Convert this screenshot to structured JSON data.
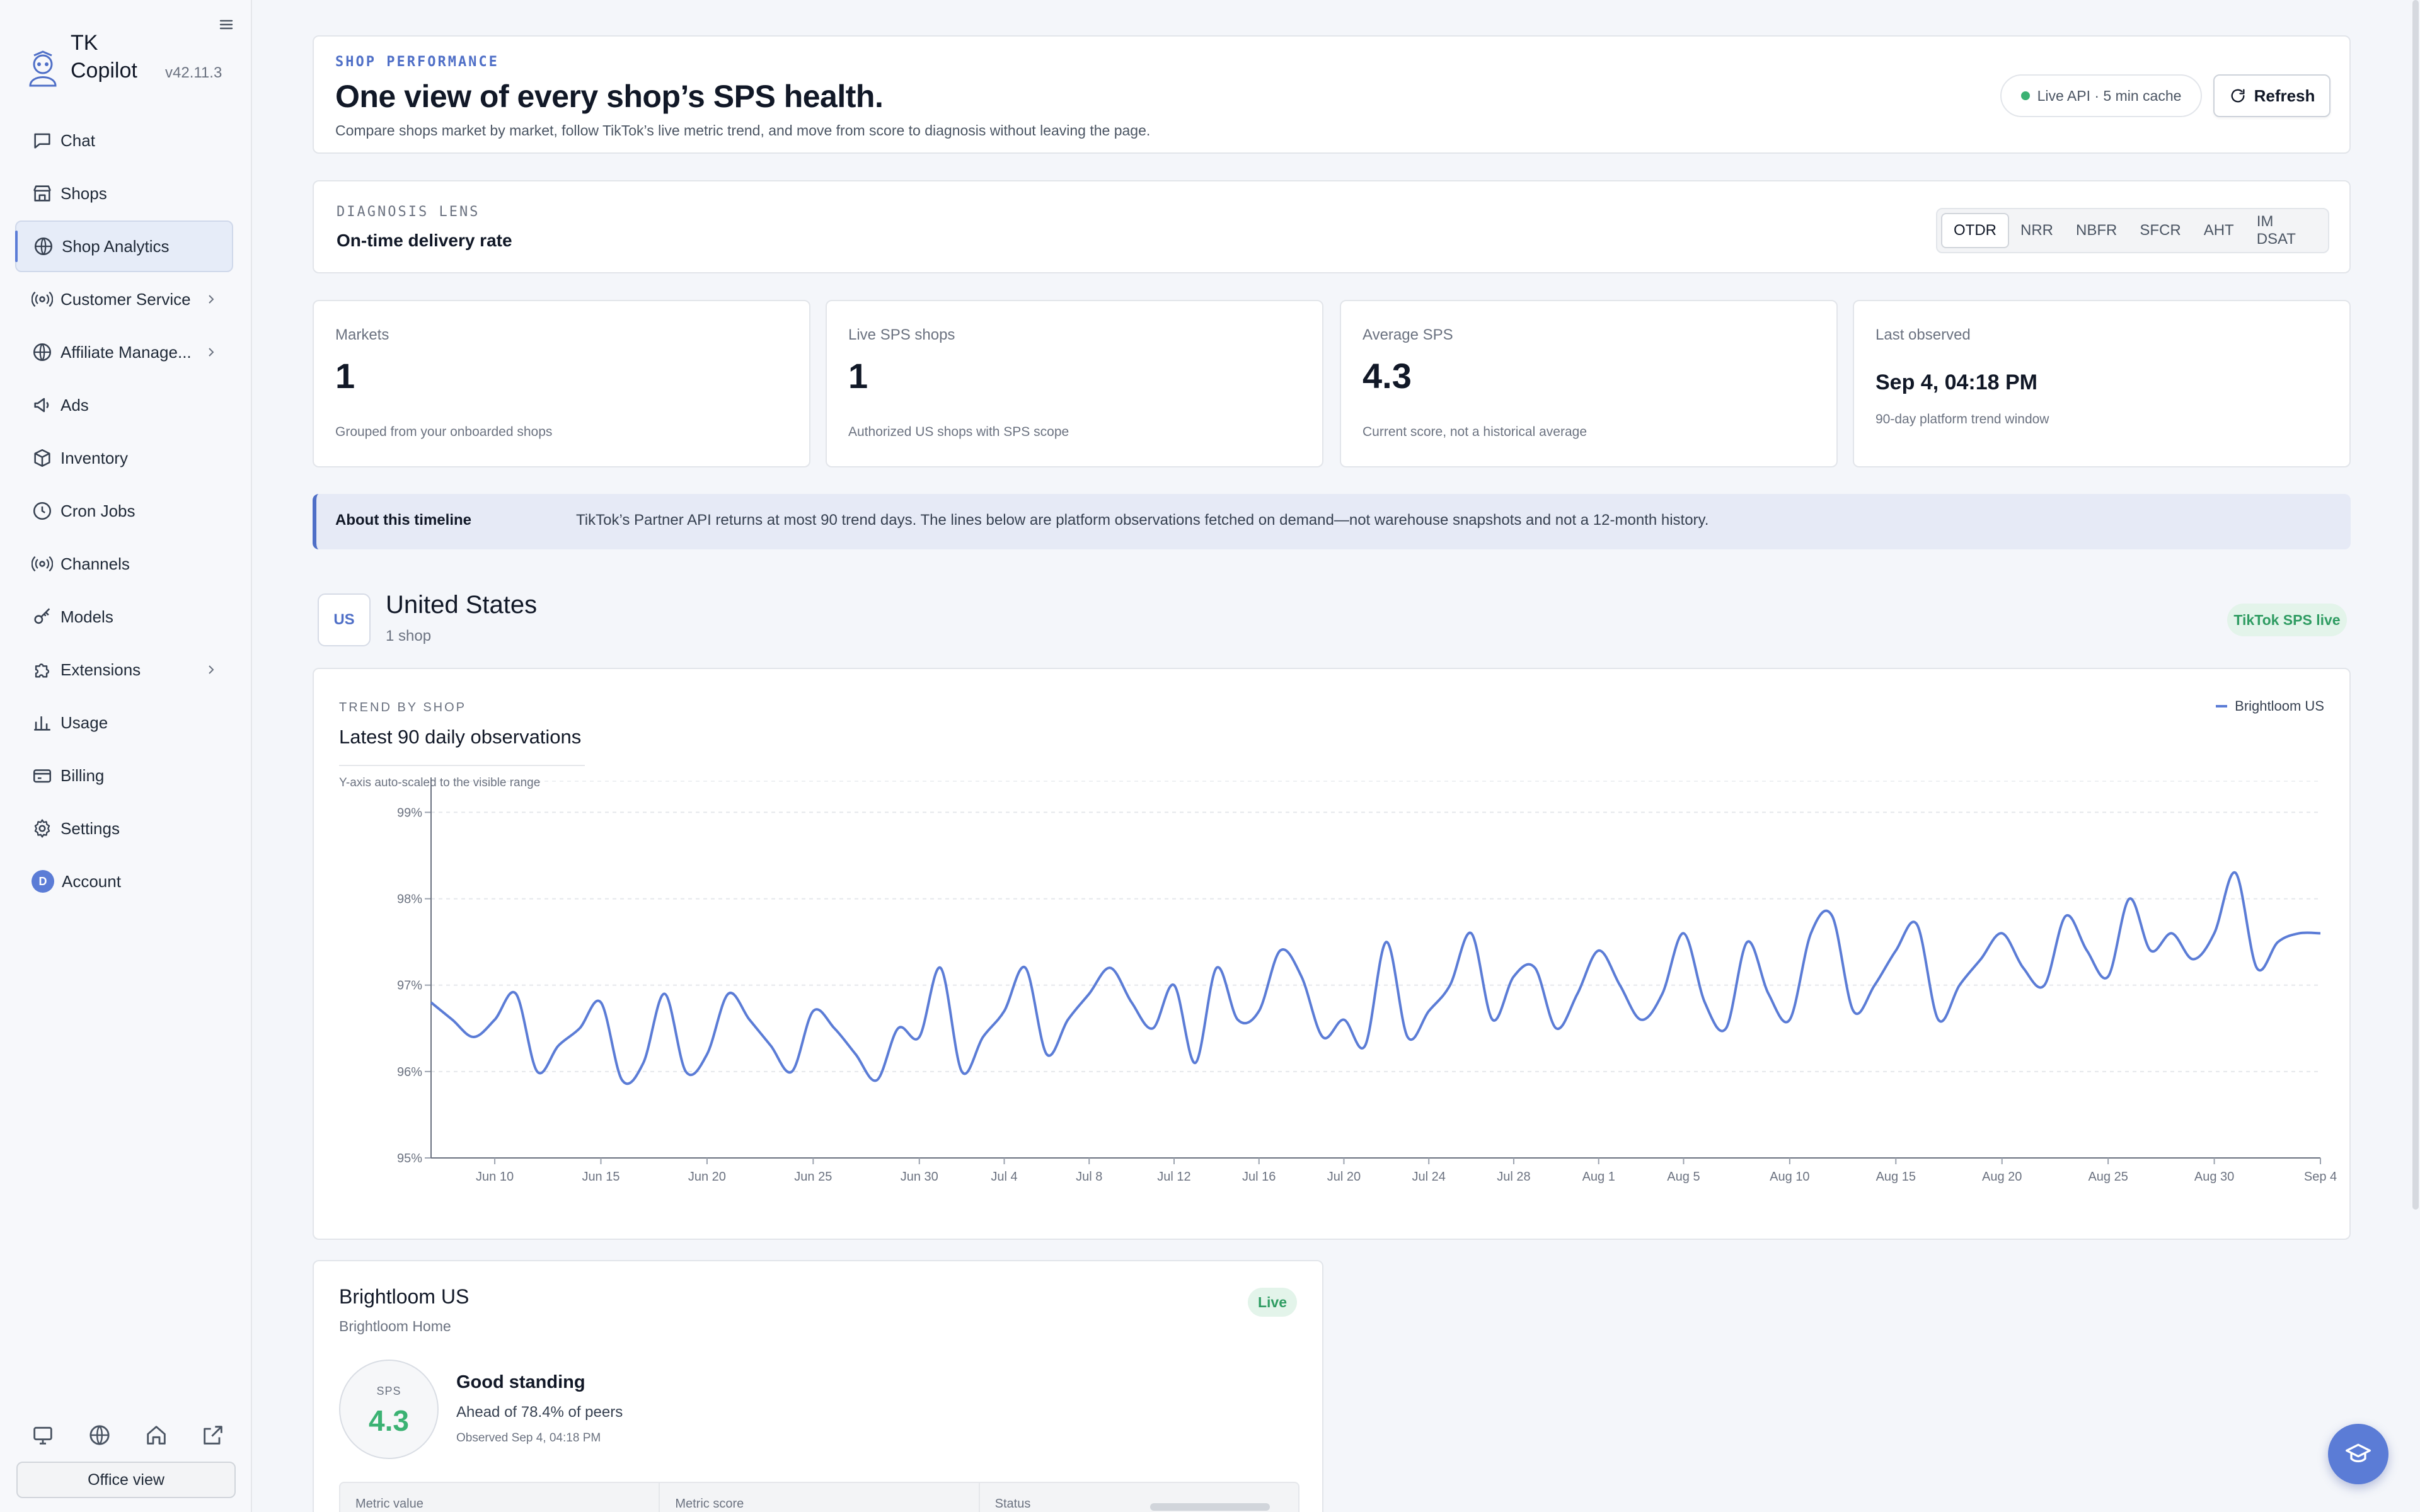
{
  "app": {
    "name": "TK Copilot",
    "version": "v42.11.3"
  },
  "sidebar": {
    "items": [
      {
        "label": "Chat",
        "icon": "chat-icon"
      },
      {
        "label": "Shops",
        "icon": "store-icon"
      },
      {
        "label": "Shop Analytics",
        "icon": "globe-icon",
        "active": true
      },
      {
        "label": "Customer Service",
        "icon": "broadcast-icon",
        "has_children": true
      },
      {
        "label": "Affiliate Manage...",
        "icon": "globe-icon",
        "has_children": true
      },
      {
        "label": "Ads",
        "icon": "megaphone-icon"
      },
      {
        "label": "Inventory",
        "icon": "box-icon"
      },
      {
        "label": "Cron Jobs",
        "icon": "clock-icon"
      },
      {
        "label": "Channels",
        "icon": "broadcast-icon"
      },
      {
        "label": "Models",
        "icon": "key-icon"
      },
      {
        "label": "Extensions",
        "icon": "puzzle-icon",
        "has_children": true
      },
      {
        "label": "Usage",
        "icon": "bar-chart-icon"
      },
      {
        "label": "Billing",
        "icon": "credit-card-icon"
      },
      {
        "label": "Settings",
        "icon": "gear-icon"
      },
      {
        "label": "Account",
        "icon": "avatar",
        "initial": "D"
      }
    ],
    "office_view": "Office view"
  },
  "hero": {
    "eyebrow": "SHOP PERFORMANCE",
    "title": "One view of every shop’s SPS health.",
    "subtitle": "Compare shops market by market, follow TikTok’s live metric trend, and move from score to diagnosis without leaving the page.",
    "status": "Live API · 5 min cache",
    "refresh": "Refresh"
  },
  "lens": {
    "eyebrow": "DIAGNOSIS LENS",
    "title": "On-time delivery rate",
    "options": [
      "OTDR",
      "NRR",
      "NBFR",
      "SFCR",
      "AHT",
      "IM DSAT"
    ],
    "selected": "OTDR"
  },
  "stats": [
    {
      "label": "Markets",
      "value": "1",
      "note": "Grouped from your onboarded shops"
    },
    {
      "label": "Live SPS shops",
      "value": "1",
      "note": "Authorized US shops with SPS scope"
    },
    {
      "label": "Average SPS",
      "value": "4.3",
      "note": "Current score, not a historical average"
    },
    {
      "label": "Last observed",
      "value": "Sep 4, 04:18 PM",
      "note": "90-day platform trend window"
    }
  ],
  "about": {
    "title": "About this timeline",
    "text": "TikTok’s Partner API returns at most 90 trend days. The lines below are platform observations fetched on demand—not warehouse snapshots and not a 12-month history."
  },
  "market": {
    "code": "US",
    "name": "United States",
    "count": "1 shop",
    "badge": "TikTok SPS live"
  },
  "chart": {
    "eyebrow": "TREND BY SHOP",
    "title": "Latest 90 daily observations",
    "note": "Y-axis auto-scaled to the visible range",
    "legend": "Brightloom US",
    "line_color": "#5b7cd6"
  },
  "chart_data": {
    "type": "line",
    "title": "Latest 90 daily observations",
    "ylim": [
      95,
      99.2
    ],
    "yticks": [
      "95%",
      "96%",
      "97%",
      "98%",
      "99%"
    ],
    "xticks": [
      "Jun 10",
      "Jun 15",
      "Jun 20",
      "Jun 25",
      "Jun 30",
      "Jul 4",
      "Jul 8",
      "Jul 12",
      "Jul 16",
      "Jul 20",
      "Jul 24",
      "Jul 28",
      "Aug 1",
      "Aug 5",
      "Aug 10",
      "Aug 15",
      "Aug 20",
      "Aug 25",
      "Aug 30",
      "Sep 4"
    ],
    "x_start": "Jun 7",
    "x_end": "Sep 4",
    "grid": true,
    "legend_position": "top-right",
    "series": [
      {
        "name": "Brightloom US",
        "values": [
          96.8,
          96.6,
          96.4,
          96.6,
          96.9,
          96.0,
          96.3,
          96.5,
          96.8,
          95.9,
          96.1,
          96.9,
          96.0,
          96.2,
          96.9,
          96.6,
          96.3,
          96.0,
          96.7,
          96.5,
          96.2,
          95.9,
          96.5,
          96.4,
          97.2,
          96.0,
          96.4,
          96.7,
          97.2,
          96.2,
          96.6,
          96.9,
          97.2,
          96.8,
          96.5,
          97.0,
          96.1,
          97.2,
          96.6,
          96.7,
          97.4,
          97.1,
          96.4,
          96.6,
          96.3,
          97.5,
          96.4,
          96.7,
          97.0,
          97.6,
          96.6,
          97.1,
          97.2,
          96.5,
          96.9,
          97.4,
          97.0,
          96.6,
          96.9,
          97.6,
          96.8,
          96.5,
          97.5,
          96.9,
          96.6,
          97.6,
          97.8,
          96.7,
          97.0,
          97.4,
          97.7,
          96.6,
          97.0,
          97.3,
          97.6,
          97.2,
          97.0,
          97.8,
          97.4,
          97.1,
          98.0,
          97.4,
          97.6,
          97.3,
          97.6,
          98.3,
          97.2,
          97.5,
          97.6,
          97.6
        ]
      }
    ]
  },
  "shop": {
    "name": "Brightloom US",
    "org": "Brightloom Home",
    "status": "Live",
    "score_label": "SPS",
    "score": "4.3",
    "standing": "Good standing",
    "peers": "Ahead of 78.4% of peers",
    "observed": "Observed Sep 4, 04:18 PM",
    "metric_cols": [
      "Metric value",
      "Metric score",
      "Status"
    ]
  }
}
